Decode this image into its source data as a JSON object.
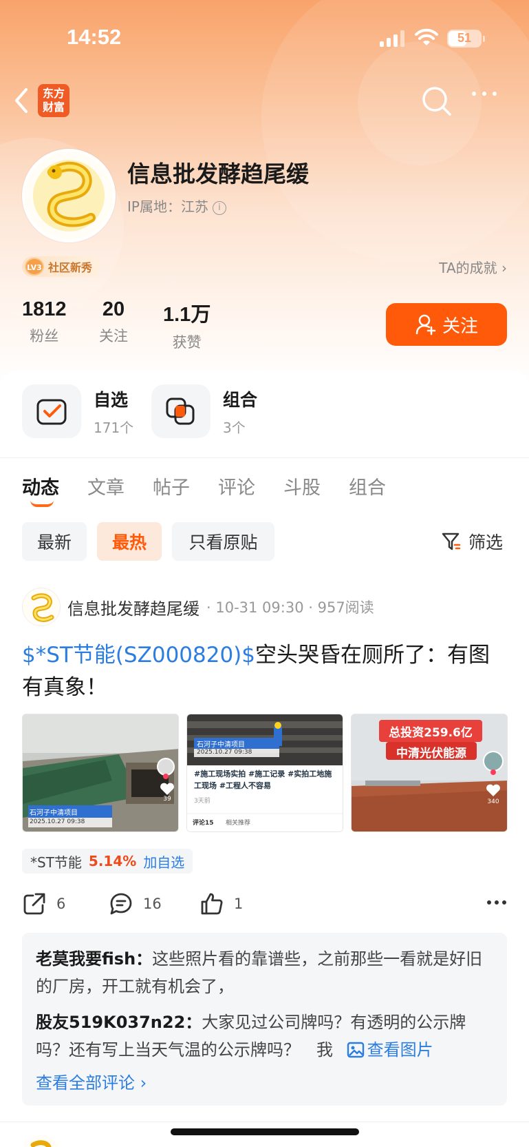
{
  "status": {
    "time": "14:52",
    "battery": "51"
  },
  "nav": {
    "brand_line1": "东方",
    "brand_line2": "财富"
  },
  "profile": {
    "name": "信息批发酵趋尾缓",
    "ip_label": "IP属地：江苏",
    "level": "LV3",
    "badge": "社区新秀",
    "achievements": "TA的成就 ›",
    "stats": [
      {
        "value": "1812",
        "label": "粉丝"
      },
      {
        "value": "20",
        "label": "关注"
      },
      {
        "value": "1.1万",
        "label": "获赞"
      }
    ],
    "follow_label": "关注"
  },
  "quick": [
    {
      "title": "自选",
      "count": "171个"
    },
    {
      "title": "组合",
      "count": "3个"
    }
  ],
  "tabs": [
    "动态",
    "文章",
    "帖子",
    "评论",
    "斗股",
    "组合"
  ],
  "filters": [
    "最新",
    "最热",
    "只看原贴"
  ],
  "filter_label": "筛选",
  "post": {
    "author": "信息批发酵趋尾缓",
    "meta": "· 10-31 09:30 · 957阅读",
    "stock_link": "$*ST节能(SZ000820)$",
    "text": "空头哭昏在厕所了：有图有真象！",
    "images": {
      "img1_banner": "石河子中清项目",
      "img1_date": "2025.10.27 09:38",
      "img1_likes": "39",
      "img2_banner": "石河子中清项目",
      "img2_date": "2025.10.27 09:38",
      "img2_tags": "#施工现场实拍 #施工记录 #实拍工地施工现场 #工程人不容易",
      "img2_time": "3天前",
      "img2_comments": "评论15",
      "img2_related": "相关推荐",
      "img3_line1": "总投资259.6亿",
      "img3_line2": "中清光伏能源",
      "img3_likes": "340"
    },
    "stock_tag": {
      "name": "*ST节能",
      "pct": "5.14%",
      "add": "加自选"
    },
    "shares": "6",
    "comments_count": "16",
    "likes": "1",
    "comments": [
      {
        "user": "老莫我要fish：",
        "text": "这些照片看的靠谱些，之前那些一看就是好旧的厂房，开工就有机会了，"
      },
      {
        "user": "股友519K037n22：",
        "text": "大家见过公司牌吗？有透明的公示牌吗？还有写上当天气温的公示牌吗？　我",
        "view_image": "查看图片"
      }
    ],
    "view_all": "查看全部评论 ›"
  },
  "colors": {
    "accent": "#ff5a0a",
    "link": "#2b7de0",
    "up": "#f04a1a"
  }
}
